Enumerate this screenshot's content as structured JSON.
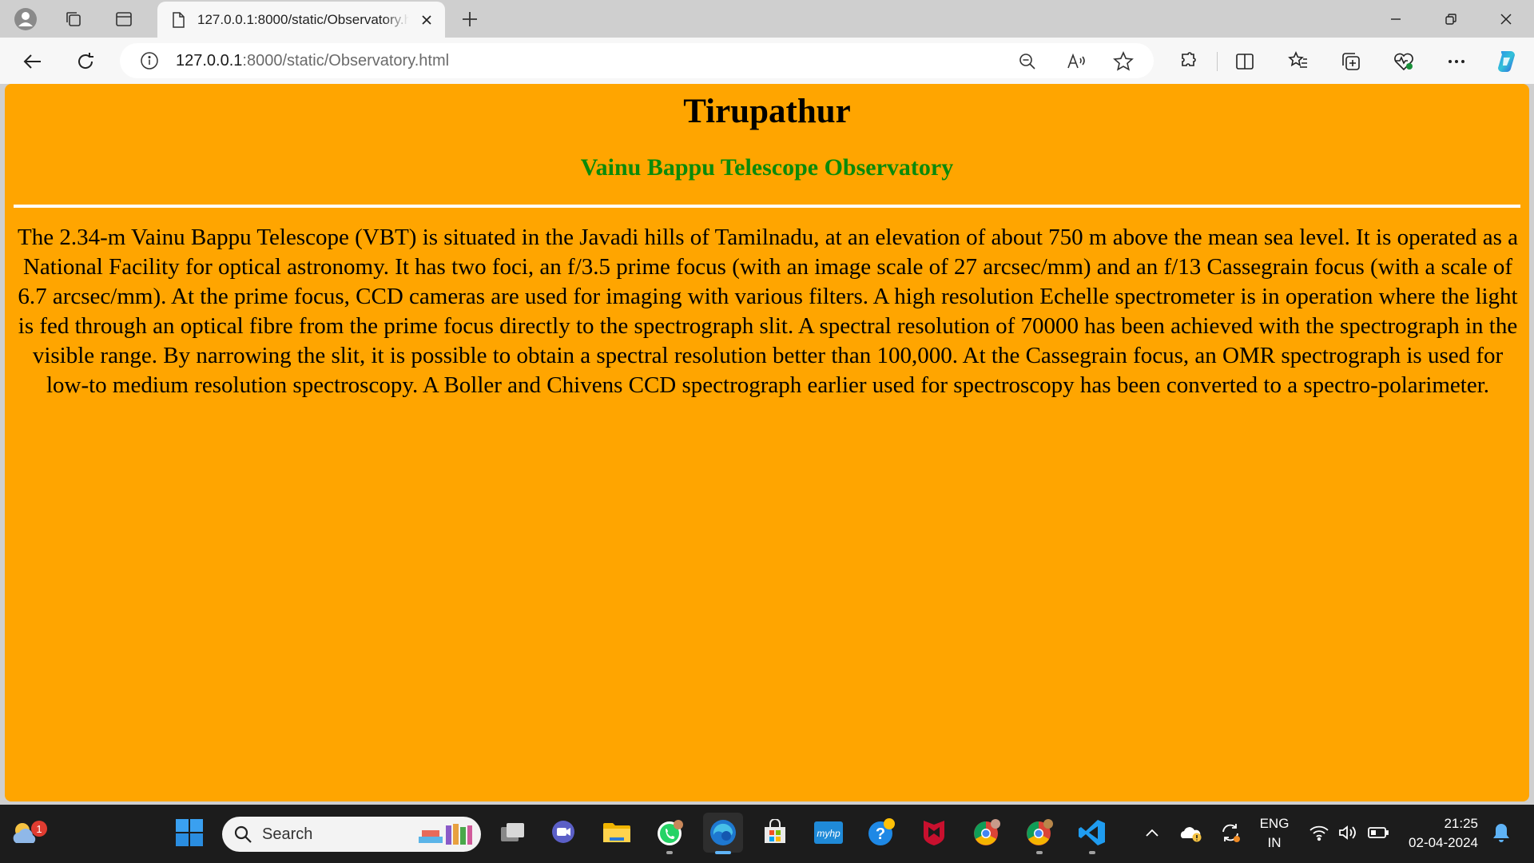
{
  "browser": {
    "tab": {
      "title": "127.0.0.1:8000/static/Observatory.html"
    },
    "address": {
      "host": "127.0.0.1",
      "path": ":8000/static/Observatory.html"
    }
  },
  "page": {
    "heading": "Tirupathur",
    "subheading": "Vainu Bappu Telescope Observatory",
    "paragraph": "The 2.34-m Vainu Bappu Telescope (VBT) is situated in the Javadi hills of Tamilnadu, at an elevation of about 750 m above the mean sea level. It is operated as a National Facility for optical astronomy. It has two foci, an f/3.5 prime focus (with an image scale of 27 arcsec/mm) and an f/13 Cassegrain focus (with a scale of 6.7 arcsec/mm). At the prime focus, CCD cameras are used for imaging with various filters. A high resolution Echelle spectrometer is in operation where the light is fed through an optical fibre from the prime focus directly to the spectrograph slit. A spectral resolution of 70000 has been achieved with the spectrograph in the visible range. By narrowing the slit, it is possible to obtain a spectral resolution better than 100,000. At the Cassegrain focus, an OMR spectrograph is used for low-to medium resolution spectroscopy. A Boller and Chivens CCD spectrograph earlier used for spectroscopy has been converted to a spectro-polarimeter.",
    "background_color": "#ffa500",
    "subheading_color": "#0a8a0a"
  },
  "taskbar": {
    "search_label": "Search",
    "weather_badge": "1",
    "language": {
      "line1": "ENG",
      "line2": "IN"
    },
    "clock": {
      "time": "21:25",
      "date": "02-04-2024"
    }
  }
}
